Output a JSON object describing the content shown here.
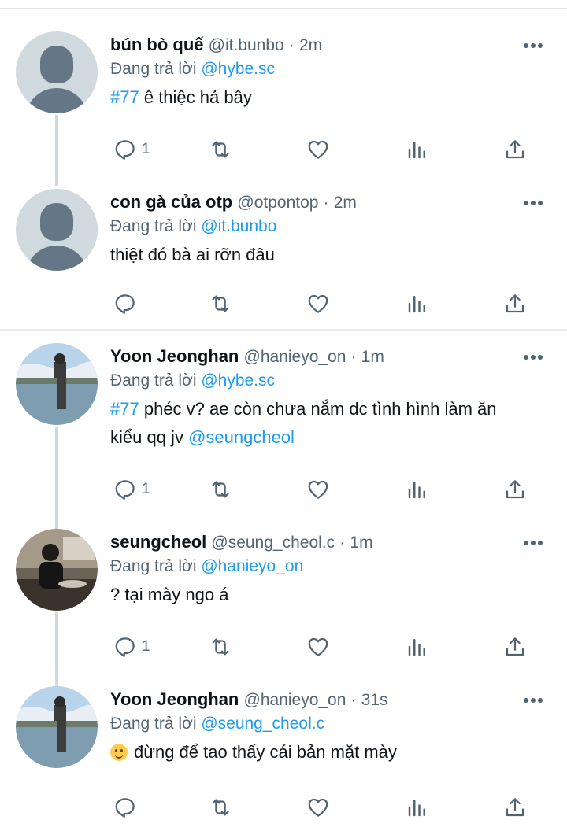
{
  "tweets": [
    {
      "name": "bún bò quế",
      "handle": "@it.bunbo",
      "dot": "·",
      "time": "2m",
      "reply_prefix": "Đang trả lời",
      "reply_to": "@hybe.sc",
      "hashtag": "#77",
      "text": "ê thiệc hả bây",
      "replies": "1",
      "avatar": "default"
    },
    {
      "name": "con gà của otp",
      "handle": "@otpontop",
      "dot": "·",
      "time": "2m",
      "reply_prefix": "Đang trả lời",
      "reply_to": "@it.bunbo",
      "text": "thiệt đó bà ai rỡn đâu",
      "replies": "",
      "avatar": "default"
    },
    {
      "name": "Yoon Jeonghan",
      "handle": "@hanieyo_on",
      "dot": "·",
      "time": "1m",
      "reply_prefix": "Đang trả lời",
      "reply_to": "@hybe.sc",
      "hashtag": "#77",
      "text": "phéc v? ae còn chưa nắm dc tình hình làm ăn",
      "text_line2": "kiểu qq jv",
      "mention": "@seungcheol",
      "replies": "1",
      "avatar": "photo-lake"
    },
    {
      "name": "seungcheol",
      "handle": "@seung_cheol.c",
      "dot": "·",
      "time": "1m",
      "reply_prefix": "Đang trả lời",
      "reply_to": "@hanieyo_on",
      "text": "? tại mày ngo á",
      "replies": "1",
      "avatar": "photo-cafe"
    },
    {
      "name": "Yoon Jeonghan",
      "handle": "@hanieyo_on",
      "dot": "·",
      "time": "31s",
      "reply_prefix": "Đang trả lời",
      "reply_to": "@seung_cheol.c",
      "text": "đừng để tao thấy cái bản mặt mày",
      "emoji": "slightly-smiling-face",
      "replies": "",
      "avatar": "photo-lake"
    }
  ],
  "icons": {
    "reply": "reply-icon",
    "retweet": "retweet-icon",
    "like": "heart-icon",
    "views": "views-icon",
    "share": "share-icon",
    "more": "more-icon"
  },
  "colors": {
    "accent": "#1d9bf0",
    "secondary_text": "#536471",
    "icon": "#536471",
    "thread_line": "#cfd9de"
  }
}
